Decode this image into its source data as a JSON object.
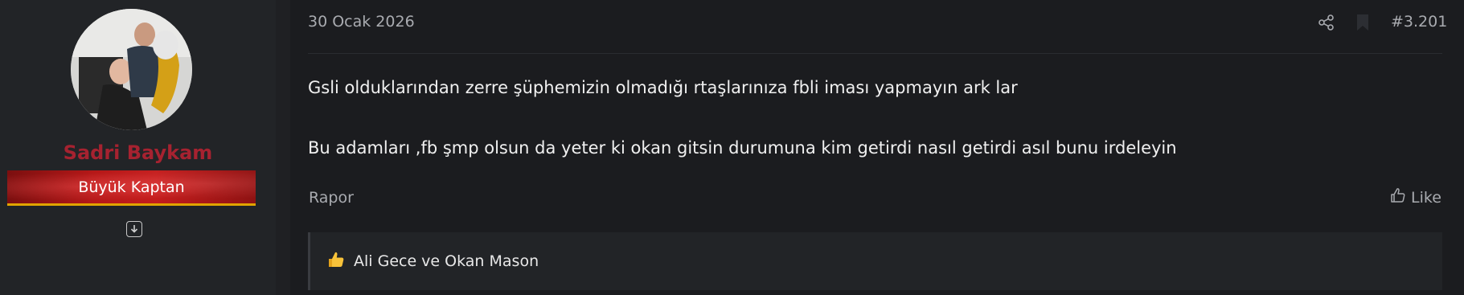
{
  "user": {
    "name": "Sadri Baykam",
    "rank": "Büyük Kaptan",
    "name_color": "#a62230"
  },
  "post": {
    "date": "30 Ocak 2026",
    "number": "#3.201",
    "lines": [
      "Gsli olduklarından zerre şüphemizin olmadığı rtaşlarınıza fbli iması yapmayın ark lar",
      "Bu adamları ,fb şmp olsun da yeter ki okan gitsin durumuna kim getirdi nasıl getirdi asıl bunu irdeleyin"
    ],
    "report_label": "Rapor",
    "like_label": "Like",
    "reactions": "Ali Gece ve Okan Mason"
  },
  "icons": {
    "share": "share-icon",
    "bookmark": "bookmark-icon",
    "expand": "expand-down-icon",
    "like": "thumbs-up-icon",
    "reaction": "thumbs-up-emoji-icon"
  }
}
